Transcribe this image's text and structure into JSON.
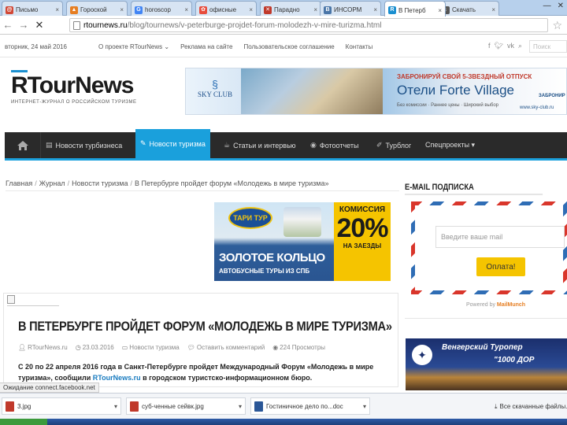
{
  "browser": {
    "tabs": [
      {
        "title": "Письмо",
        "favicon_color": "#d14836",
        "favicon": "@"
      },
      {
        "title": "Гороской",
        "favicon_color": "#e67e22",
        "favicon": "▲"
      },
      {
        "title": "horoscop",
        "favicon_color": "#4285f4",
        "favicon": "G"
      },
      {
        "title": "офисные",
        "favicon_color": "#e74c3c",
        "favicon": "✿"
      },
      {
        "title": "Парадно",
        "favicon_color": "#c0392b",
        "favicon": "✕"
      },
      {
        "title": "ИНСОРМ",
        "favicon_color": "#4a76a8",
        "favicon": "В"
      },
      {
        "title": "В Петерб",
        "favicon_color": "#1a8fd0",
        "favicon": "R",
        "active": true
      },
      {
        "title": "Скачать",
        "favicon_color": "#555555",
        "favicon": "↓"
      }
    ],
    "url_host": "rtournews.ru",
    "url_path": "/blog/tournews/v-peterburge-projdet-forum-molodezh-v-mire-turizma.html"
  },
  "topbar": {
    "date": "вторник, 24 май 2016",
    "menu": [
      "О проекте RTourNews ⌄",
      "Реклама на сайте",
      "Пользовательское соглашение",
      "Контакты"
    ],
    "search_placeholder": "Поиск"
  },
  "header": {
    "logo_text": "TourNews",
    "logo_r": "R",
    "tagline": "ИНТЕРНЕТ-ЖУРНАЛ О РОССИЙСКОМ ТУРИЗМЕ",
    "banner": {
      "sky_text": "SKY CLUB",
      "line1": "ЗАБРОНИРУЙ СВОЙ 5-ЗВЕЗДНЫЙ ОТПУСК",
      "line2": "Отели Forte Village",
      "line3": "Без комиссии · Раннее цены · Широкий выбор",
      "line4": "ЗАБРОНИР",
      "line5": "www.sky-club.ru"
    }
  },
  "nav": {
    "items": [
      {
        "label": "Новости турбизнеса",
        "icon": "▤"
      },
      {
        "label": "Новости туризма",
        "icon": "✎",
        "active": true
      },
      {
        "label": "Статьи и интервью",
        "icon": "☕"
      },
      {
        "label": "Фотоотчеты",
        "icon": "◉"
      },
      {
        "label": "Турблог",
        "icon": "✐"
      },
      {
        "label": "Спецпроекты ▾",
        "icon": ""
      }
    ]
  },
  "breadcrumb": [
    "Главная",
    "Журнал",
    "Новости туризма",
    "В Петербурге пройдет форум «Молодежь в мире туризма»"
  ],
  "ad_mid": {
    "badge": "ТАРИ ТУР",
    "line1": "ЗОЛОТОЕ КОЛЬЦО",
    "line2": "АВТОБУСНЫЕ ТУРЫ ИЗ СПБ",
    "commission": "КОМИССИЯ",
    "percent": "20%",
    "per_trip": "НА ЗАЕЗДЫ"
  },
  "article": {
    "title": "В ПЕТЕРБУРГЕ ПРОЙДЕТ ФОРУМ «МОЛОДЕЖЬ В МИРЕ ТУРИЗМА»",
    "meta": {
      "author": "RTourNews.ru",
      "date": "23.03.2016",
      "category": "Новости туризма",
      "comments": "Оставить комментарий",
      "views": "224 Просмотры"
    },
    "body_bold_1": "С 20 по 22 апреля 2016 года",
    "body_text_1": " в Санкт-Петербурге пройдет Международный Форум «Молодежь в мире туризма», ",
    "body_text_2": "сообщили ",
    "body_link": "RTourNews.ru",
    "body_text_3": " в городском туристско-информационном бюро."
  },
  "sidebar": {
    "email_title": "E-MAIL ПОДПИСКА",
    "email_placeholder": "Введите ваше mail",
    "submit_label": "Оплата!",
    "powered_prefix": "Powered by ",
    "powered_brand": "MailMunch",
    "ad_line1": "Венгерский Туропер",
    "ad_line2": "\"1000 ДОР"
  },
  "status_text": "Ожидание connect.facebook.net",
  "downloads": [
    {
      "name": "3.jpg",
      "color": "#c0392b"
    },
    {
      "name": "суб-ченные сейвк.jpg",
      "color": "#c0392b"
    },
    {
      "name": "Гостиничное дело по...doc",
      "color": "#2b5797"
    }
  ],
  "all_downloads_label": "Все скачанные файлы..."
}
